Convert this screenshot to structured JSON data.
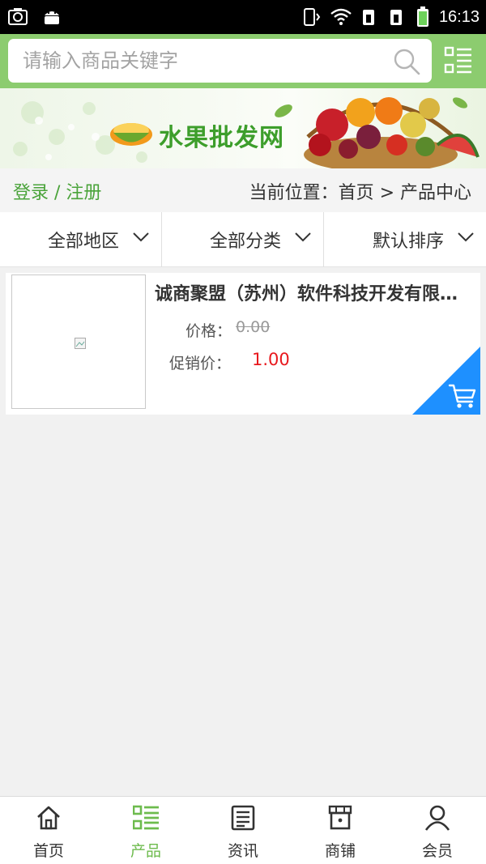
{
  "status_bar": {
    "time": "16:13"
  },
  "search": {
    "placeholder": "请输入商品关键字"
  },
  "banner": {
    "site_name": "水果批发网",
    "accent_color": "#3d9e2b"
  },
  "breadcrumb": {
    "login_text": "登录 / 注册",
    "location_text": "当前位置：首页 > 产品中心"
  },
  "filters": [
    {
      "label": "全部地区",
      "icon": "chevron-down-icon"
    },
    {
      "label": "全部分类",
      "icon": "chevron-down-icon"
    },
    {
      "label": "默认排序",
      "icon": "chevron-down-icon"
    }
  ],
  "product": {
    "name": "诚商聚盟（苏州）软件科技开发有限公司",
    "price_label": "价格：",
    "price_value": "0.00",
    "promo_label": "促销价：",
    "promo_value": "1.00",
    "cart_icon": "cart-icon",
    "cart_color": "#1e90ff"
  },
  "bottom_nav": [
    {
      "label": "首页",
      "icon": "home-icon",
      "active": false
    },
    {
      "label": "产品",
      "icon": "list-icon",
      "active": true
    },
    {
      "label": "资讯",
      "icon": "news-icon",
      "active": false
    },
    {
      "label": "商铺",
      "icon": "store-icon",
      "active": false
    },
    {
      "label": "会员",
      "icon": "user-icon",
      "active": false
    }
  ],
  "colors": {
    "header": "#8ccc6f",
    "active_nav": "#6dbb4d",
    "promo_price": "#e8181d"
  }
}
